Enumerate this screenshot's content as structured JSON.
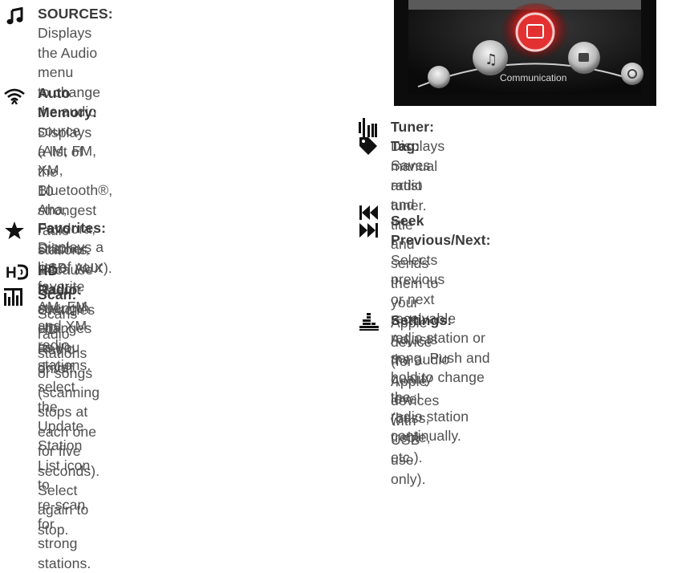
{
  "left_items": [
    {
      "icon": "music-note-icon",
      "title": "SOURCES:",
      "lines": [
        " Displays the Audio menu",
        "to change the audio source (AM, FM,",
        "XM, Bluetooth®, Aha, Pandora, Stitcher,",
        "USB, AUX)."
      ]
    },
    {
      "icon": "wifi-icon",
      "title": "Auto Memory:",
      "lines": [
        " Displays a list of the",
        "10 strongest radio stations. Because",
        "station strength changes as you drive,",
        "select the Update Station List icon to",
        "re-scan for strong stations."
      ]
    },
    {
      "icon": "star-icon",
      "title": "Favorites:",
      "lines": [
        " Displays a list of your",
        "favorite AM, FM, and XM radio stations."
      ]
    },
    {
      "icon": "hd-radio-icon",
      "title": "HD Radio:",
      "lines": [
        " Switches HD Radio on/off."
      ]
    },
    {
      "icon": "scan-icon",
      "title": "Scan:",
      "lines": [
        " Scans radio stations or songs",
        "(scanning stops at each one for five",
        "seconds). Select again to stop."
      ]
    }
  ],
  "right_items": [
    {
      "icon": "tuner-icon",
      "title": "Tuner:",
      "lines": [
        " Displays manual radio tuner."
      ]
    },
    {
      "icon": "tag-icon",
      "title": "Tag:",
      "lines": [
        " Saves artist and title and sends",
        "them to your Apple device (for Apple",
        "devices with USB use only)."
      ]
    },
    {
      "icon": "seek-icon",
      "title": "Seek Previous/Next:",
      "lines": [
        " Selects previous",
        "or next receivable radio station or",
        "song. Push and hold to change the",
        "radio station continually."
      ]
    },
    {
      "icon": "settings-icon",
      "title": "Settings:",
      "lines": [
        " Adjusts the audio quality",
        "level (bass, treble, etc.)."
      ]
    }
  ],
  "photo": {
    "label": "Communication"
  }
}
